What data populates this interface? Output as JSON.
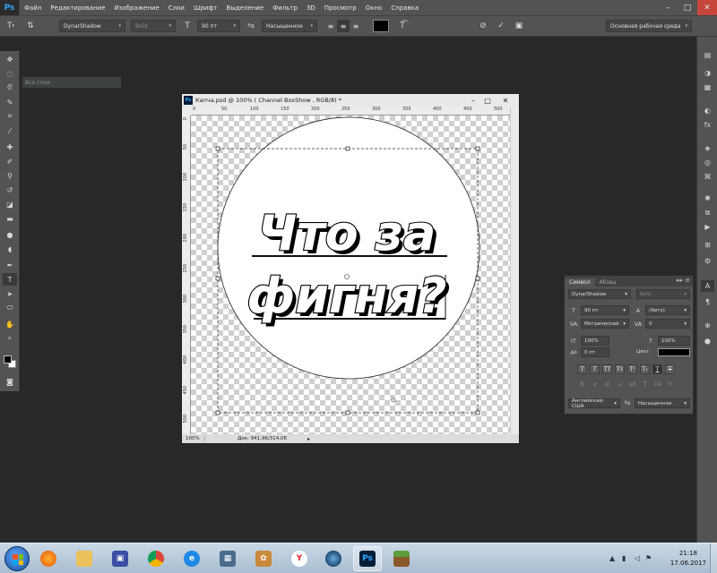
{
  "menubar": {
    "logo": "Ps",
    "items": [
      "Файл",
      "Редактирование",
      "Изображение",
      "Слои",
      "Шрифт",
      "Выделение",
      "Фильтр",
      "3D",
      "Просмотр",
      "Окно",
      "Справка"
    ]
  },
  "options_bar": {
    "font_family": "DynarShadow",
    "font_style": "Bold",
    "font_size": "90 пт",
    "antialias": "Насыщенное",
    "workspace": "Основная рабочая среда",
    "text_color": "#000000"
  },
  "layers_strip": "Все слои",
  "document": {
    "title": "Капча.psd @ 100% ( Channel BoxShow , RGB/8) *",
    "ruler_h": [
      "0",
      "50",
      "100",
      "150",
      "200",
      "250",
      "300",
      "350",
      "400",
      "450",
      "500"
    ],
    "ruler_v": [
      "0",
      "50",
      "100",
      "150",
      "200",
      "250",
      "300",
      "350",
      "400",
      "450",
      "500"
    ],
    "text_line1": "Что за",
    "text_line2": "фигня?",
    "zoom": "100%",
    "doc_info": "Док: 941,9K/314,0K"
  },
  "character_panel": {
    "tabs": [
      "Символ",
      "Абзац"
    ],
    "font_family": "DynarShadow",
    "font_style": "Bold",
    "size": "90 пт",
    "leading": "(Авто)",
    "kerning": "Метрический",
    "tracking": "0",
    "vscale": "100%",
    "hscale": "100%",
    "baseline": "0 пт",
    "color_label": "Цвет:",
    "language": "Английский: США",
    "antialias": "Насыщенное",
    "text_color": "#000000"
  },
  "taskbar": {
    "time": "21:18",
    "date": "17.06.2017"
  }
}
